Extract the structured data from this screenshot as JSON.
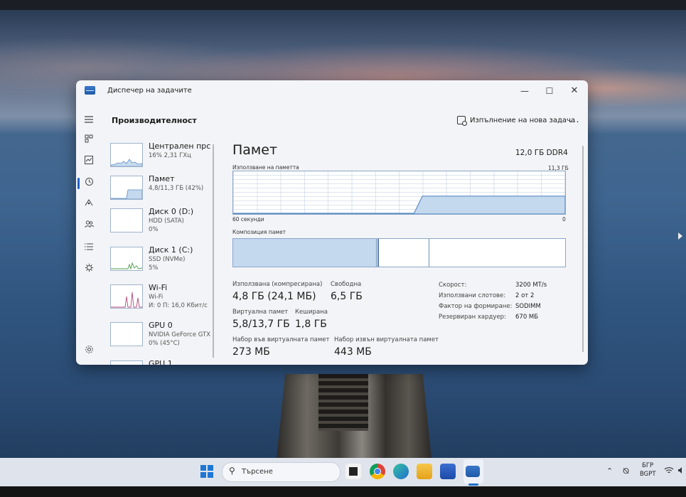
{
  "window": {
    "title": "Диспечер на задачите",
    "controls": {
      "minimize": "—",
      "maximize": "☐",
      "close": "✕"
    }
  },
  "header": {
    "page_title": "Производителност",
    "run_new_task": "Изпълнение на нова задача",
    "more": "..."
  },
  "nav_icons": [
    "hamburger-icon",
    "processes-icon",
    "performance-icon",
    "history-icon",
    "startup-icon",
    "users-icon",
    "details-icon",
    "services-icon",
    "settings-icon"
  ],
  "resources": [
    {
      "name": "Централен прс",
      "sub1": "16% 2,31 ГХц",
      "sub2": ""
    },
    {
      "name": "Памет",
      "sub1": "4,8/11,3 ГБ (42%)",
      "sub2": ""
    },
    {
      "name": "Диск 0 (D:)",
      "sub1": "HDD (SATA)",
      "sub2": "0%"
    },
    {
      "name": "Диск 1 (C:)",
      "sub1": "SSD (NVMe)",
      "sub2": "5%"
    },
    {
      "name": "Wi-Fi",
      "sub1": "Wi-Fi",
      "sub2": "И: 0 П: 16,0 Кбит/с"
    },
    {
      "name": "GPU 0",
      "sub1": "NVIDIA GeForce GTX",
      "sub2": "0% (45°C)"
    },
    {
      "name": "GPU 1",
      "sub1": "",
      "sub2": ""
    }
  ],
  "memory": {
    "title": "Памет",
    "total": "12,0 ГБ DDR4",
    "usage_label": "Използване на паметта",
    "usage_max": "11,3 ГБ",
    "time_left": "60 секунди",
    "time_right": "0",
    "usage_fraction": 0.42,
    "composition_label": "Композиция памет",
    "stats": {
      "in_use_label": "Използвана (компресирана)",
      "in_use_value": "4,8 ГБ (24,1 МБ)",
      "available_label": "Свободна",
      "available_value": "6,5 ГБ",
      "committed_label": "Виртуална памет",
      "committed_value": "5,8/13,7 ГБ",
      "cached_label": "Кеширана",
      "cached_value": "1,8 ГБ",
      "paged_label": "Набор във виртуалната памет",
      "paged_value": "273 МБ",
      "nonpaged_label": "Набор извън виртуалната памет",
      "nonpaged_value": "443 МБ"
    },
    "specs": [
      {
        "k": "Скорост:",
        "v": "3200 MT/s"
      },
      {
        "k": "Използвани слотове:",
        "v": "2 от 2"
      },
      {
        "k": "Фактор на формиране:",
        "v": "SODIMM"
      },
      {
        "k": "Резервиран хардуер:",
        "v": "670 МБ"
      }
    ]
  },
  "taskbar": {
    "search_placeholder": "Търсене",
    "lang_line1": "БГР",
    "lang_line2": "BGPT"
  }
}
